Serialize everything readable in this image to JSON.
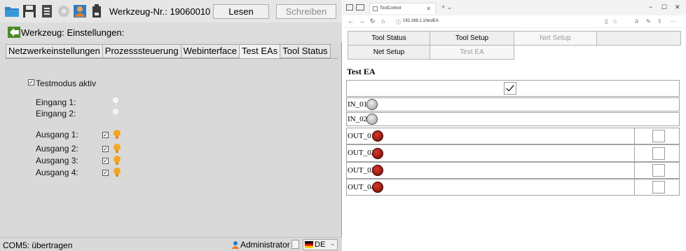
{
  "left_app": {
    "toolbar": {
      "werkzeug_label": "Werkzeug-Nr.: 19060010",
      "read_button": "Lesen",
      "write_button": "Schreiben",
      "icons": [
        "folder-icon",
        "save-icon",
        "list-icon",
        "gear-icon",
        "user-icon",
        "device-icon"
      ]
    },
    "settings_title": "Werkzeug: Einstellungen:",
    "tabs": [
      {
        "label": "Netzwerkeinstellungen",
        "active": false
      },
      {
        "label": "Prozesssteuerung",
        "active": false
      },
      {
        "label": "Webinterface",
        "active": false
      },
      {
        "label": "Test EAs",
        "active": true
      },
      {
        "label": "Tool Status",
        "active": false
      }
    ],
    "testmode_label": "Testmodus aktiv",
    "testmode_checked": true,
    "inputs": [
      {
        "label": "Eingang 1:",
        "state": "off"
      },
      {
        "label": "Eingang 2:",
        "state": "off"
      }
    ],
    "outputs": [
      {
        "label": "Ausgang 1:",
        "checked": true,
        "state": "on"
      },
      {
        "label": "Ausgang 2:",
        "checked": true,
        "state": "on"
      },
      {
        "label": "Ausgang 3:",
        "checked": true,
        "state": "on"
      },
      {
        "label": "Ausgang 4:",
        "checked": true,
        "state": "on"
      }
    ],
    "status": {
      "message": "COM5: übertragen",
      "user": "Administrator",
      "language": "DE"
    }
  },
  "browser": {
    "tab_title": "ToolControl",
    "url": "192.168.1.1/testEA"
  },
  "web": {
    "nav_row1": [
      {
        "label": "Tool Status",
        "enabled": true
      },
      {
        "label": "Tool Setup",
        "enabled": true
      },
      {
        "label": "Net Setup",
        "enabled": false
      },
      {
        "label": "",
        "enabled": true
      }
    ],
    "nav_row2": [
      {
        "label": "Net Setup",
        "enabled": true
      },
      {
        "label": "Test EA",
        "enabled": false
      }
    ],
    "title": "Test EA",
    "inputs": [
      {
        "label": "IN_01",
        "state": "off"
      },
      {
        "label": "IN_02",
        "state": "off"
      }
    ],
    "outputs": [
      {
        "label": "OUT_01",
        "state": "on"
      },
      {
        "label": "OUT_02",
        "state": "on"
      },
      {
        "label": "OUT_03",
        "state": "on"
      },
      {
        "label": "OUT_04",
        "state": "on"
      }
    ],
    "colors": {
      "led_on": "#9b1c12",
      "led_off": "#bdbdbd",
      "bulb_on": "#f5a623"
    }
  }
}
